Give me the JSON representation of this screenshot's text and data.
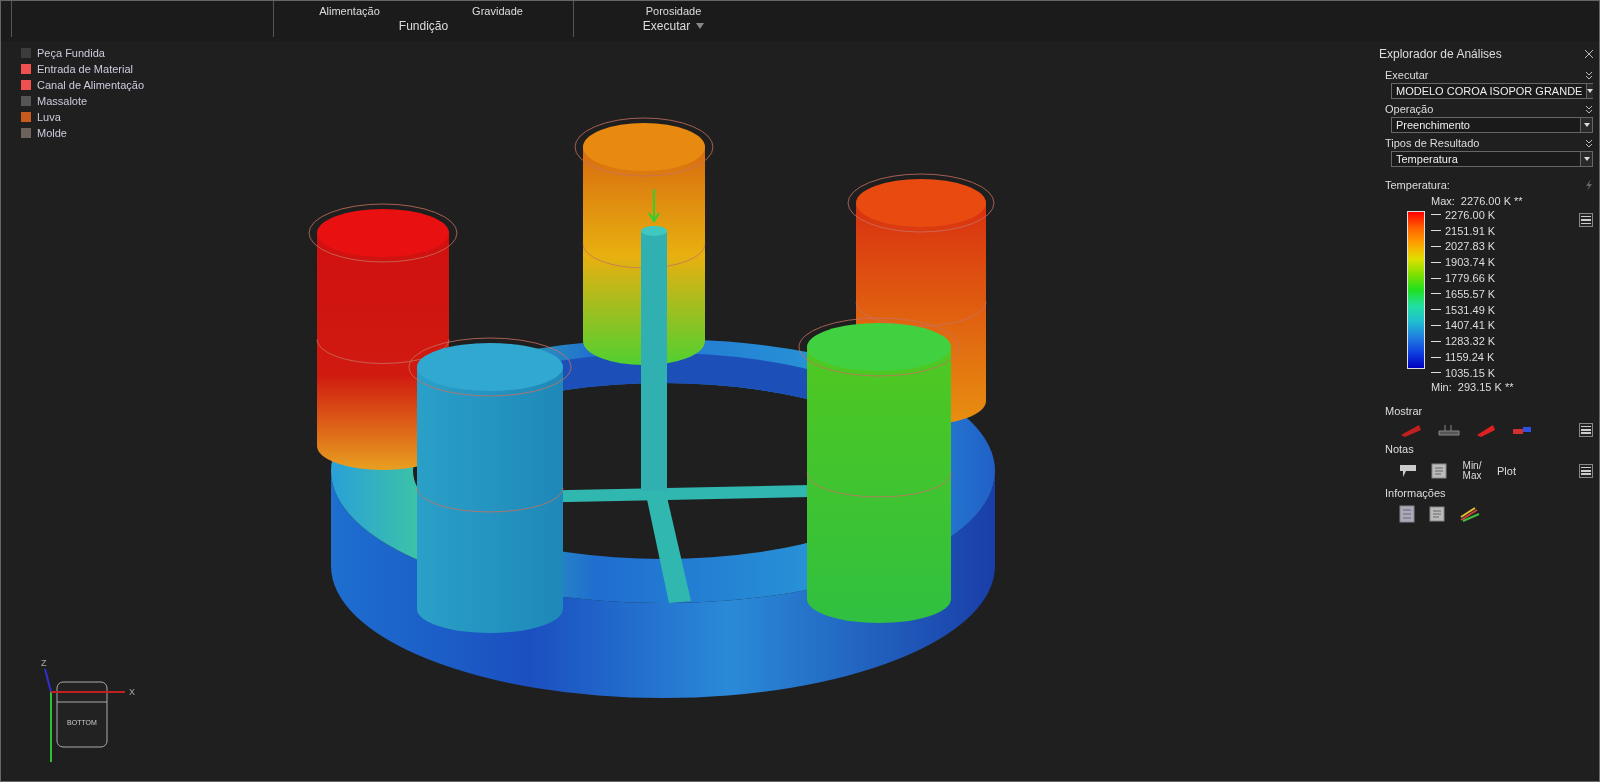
{
  "ribbon": {
    "groups": [
      {
        "label": "Fundição",
        "items": [
          "Alimentação",
          "Gravidade"
        ]
      },
      {
        "label": "Executar",
        "items": [
          "Porosidade"
        ]
      }
    ]
  },
  "components_legend": [
    {
      "label": "Peça Fundida",
      "color": "#3c3c3c"
    },
    {
      "label": "Entrada de Material",
      "color": "#f05050"
    },
    {
      "label": "Canal de Alimentação",
      "color": "#f05050"
    },
    {
      "label": "Massalote",
      "color": "#555555"
    },
    {
      "label": "Luva",
      "color": "#c85a1e"
    },
    {
      "label": "Molde",
      "color": "#6e625c"
    }
  ],
  "view_cube": {
    "face": "BOTTOM",
    "axes": [
      "Z",
      "X"
    ]
  },
  "panel": {
    "title": "Explorador de Análises",
    "selectors": [
      {
        "label": "Executar",
        "value": "MODELO COROA ISOPOR GRANDE"
      },
      {
        "label": "Operação",
        "value": "Preenchimento"
      },
      {
        "label": "Tipos de Resultado",
        "value": "Temperatura"
      }
    ],
    "scale": {
      "title": "Temperatura:",
      "max_label": "Max:",
      "max": "2276.00 K **",
      "min_label": "Min:",
      "min": "293.15 K **",
      "ticks": [
        "2276.00 K",
        "2151.91 K",
        "2027.83 K",
        "1903.74 K",
        "1779.66 K",
        "1655.57 K",
        "1531.49 K",
        "1407.41 K",
        "1283.32 K",
        "1159.24 K",
        "1035.15 K"
      ]
    },
    "show_title": "Mostrar",
    "notes_title": "Notas",
    "notes_texts": [
      "Min/ Max",
      "Plot"
    ],
    "info_title": "Informações"
  }
}
